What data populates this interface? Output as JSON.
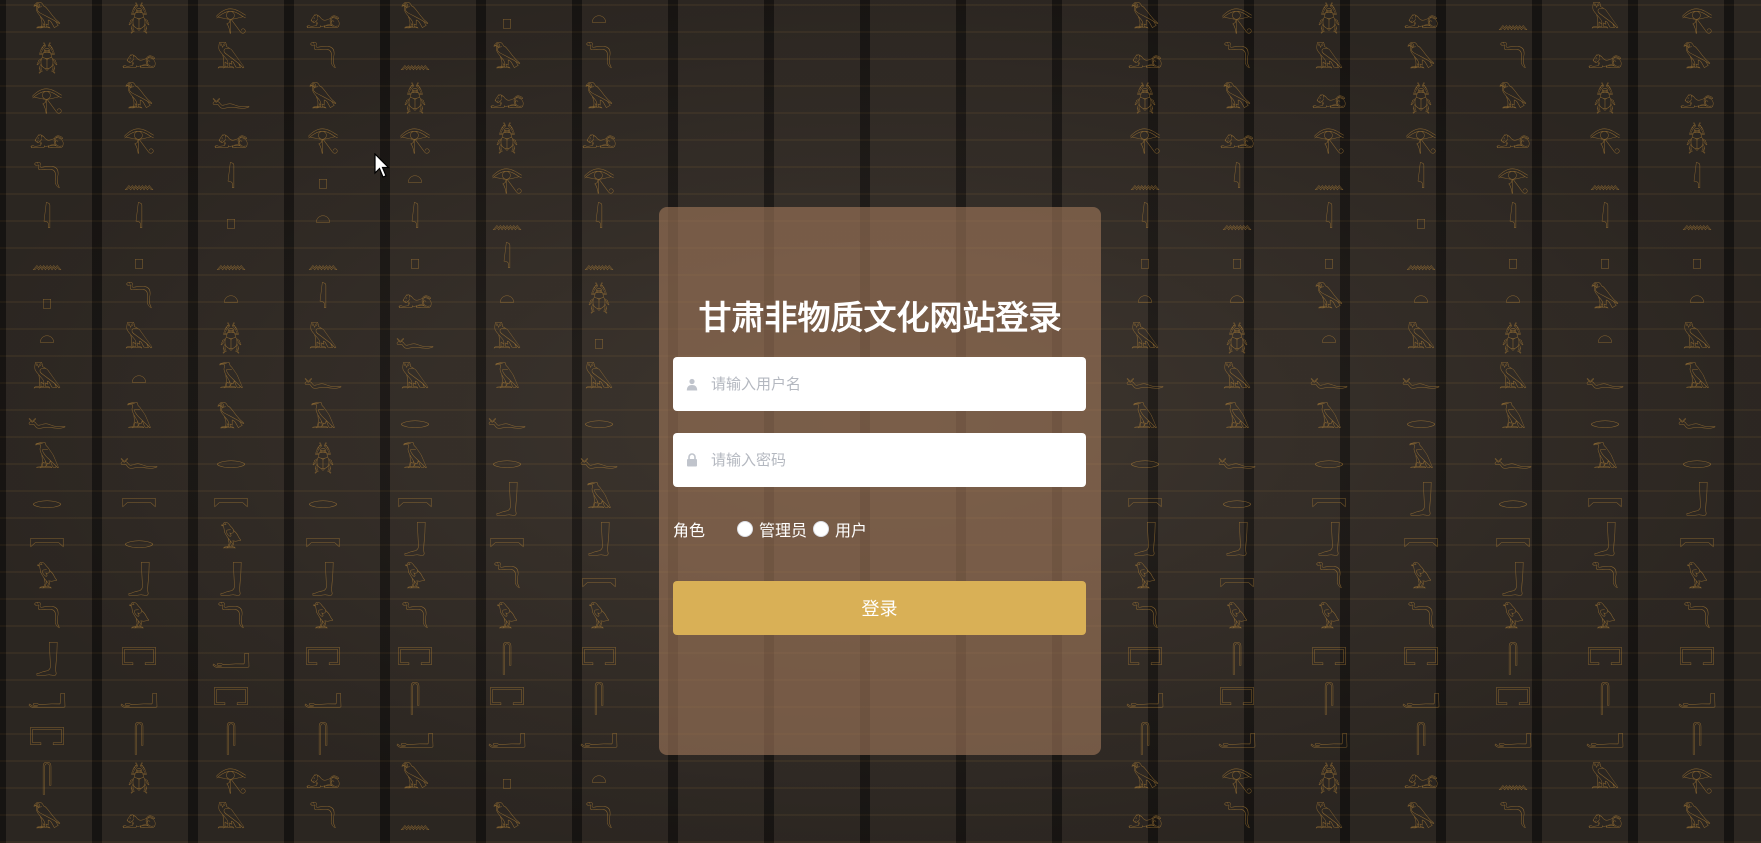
{
  "login": {
    "title": "甘肃非物质文化网站登录",
    "username_placeholder": "请输入用户名",
    "password_placeholder": "请输入密码",
    "role_label": "角色",
    "roles": [
      {
        "label": "管理员"
      },
      {
        "label": "用户"
      }
    ],
    "submit_label": "登录"
  },
  "icons": {
    "username": "user-icon",
    "password": "lock-icon"
  },
  "colors": {
    "card_background": "#a0785a",
    "button": "#d9b056",
    "title_text": "#ffffff"
  }
}
